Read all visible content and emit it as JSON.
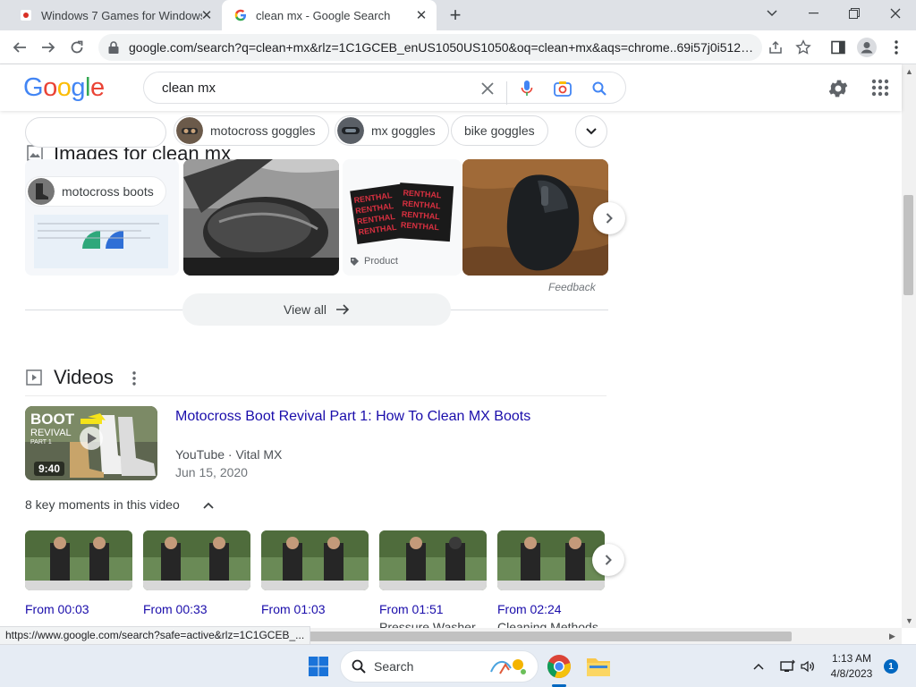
{
  "browser": {
    "tabs": [
      {
        "title": "Windows 7 Games for Windows 11/10",
        "active": false
      },
      {
        "title": "clean mx - Google Search",
        "active": true
      }
    ],
    "url": "google.com/search?q=clean+mx&rlz=1C1GCEB_enUS1050US1050&oq=clean+mx&aqs=chrome..69i57j0i512l9...."
  },
  "google": {
    "logo": [
      "G",
      "o",
      "o",
      "g",
      "l",
      "e"
    ],
    "logo_colors": [
      "#4285f4",
      "#ea4335",
      "#fbbc05",
      "#4285f4",
      "#34a853",
      "#ea4335"
    ],
    "search_query": "clean mx"
  },
  "images": {
    "heading": "Images for clean mx",
    "chips": [
      "motocross goggles",
      "mx goggles",
      "bike goggles",
      "motocross boots"
    ],
    "product_label": "Product",
    "feedback": "Feedback",
    "view_all": "View all",
    "renthal_text": "RENTHAL"
  },
  "videos": {
    "heading": "Videos",
    "title": "Motocross Boot Revival Part 1: How To Clean MX Boots",
    "source": "YouTube · Vital MX",
    "date": "Jun 15, 2020",
    "duration": "9:40",
    "thumb_text_1": "BOOT",
    "thumb_text_2": "REVIVAL",
    "thumb_text_3": "PART 1",
    "key_moments_label": "8 key moments in this video",
    "moments": [
      {
        "time": "From 00:03",
        "caption": ""
      },
      {
        "time": "From 00:33",
        "caption": ""
      },
      {
        "time": "From 01:03",
        "caption": ""
      },
      {
        "time": "From 01:51",
        "caption": "Pressure Washer"
      },
      {
        "time": "From 02:24",
        "caption": "Cleaning Methods"
      }
    ]
  },
  "status_url": "https://www.google.com/search?safe=active&rlz=1C1GCEB_...",
  "taskbar": {
    "search_label": "Search",
    "time": "1:13 AM",
    "date": "4/8/2023",
    "notification_count": "1"
  },
  "colors": {
    "link": "#1a0dab",
    "accent_blue": "#1a73e8"
  }
}
